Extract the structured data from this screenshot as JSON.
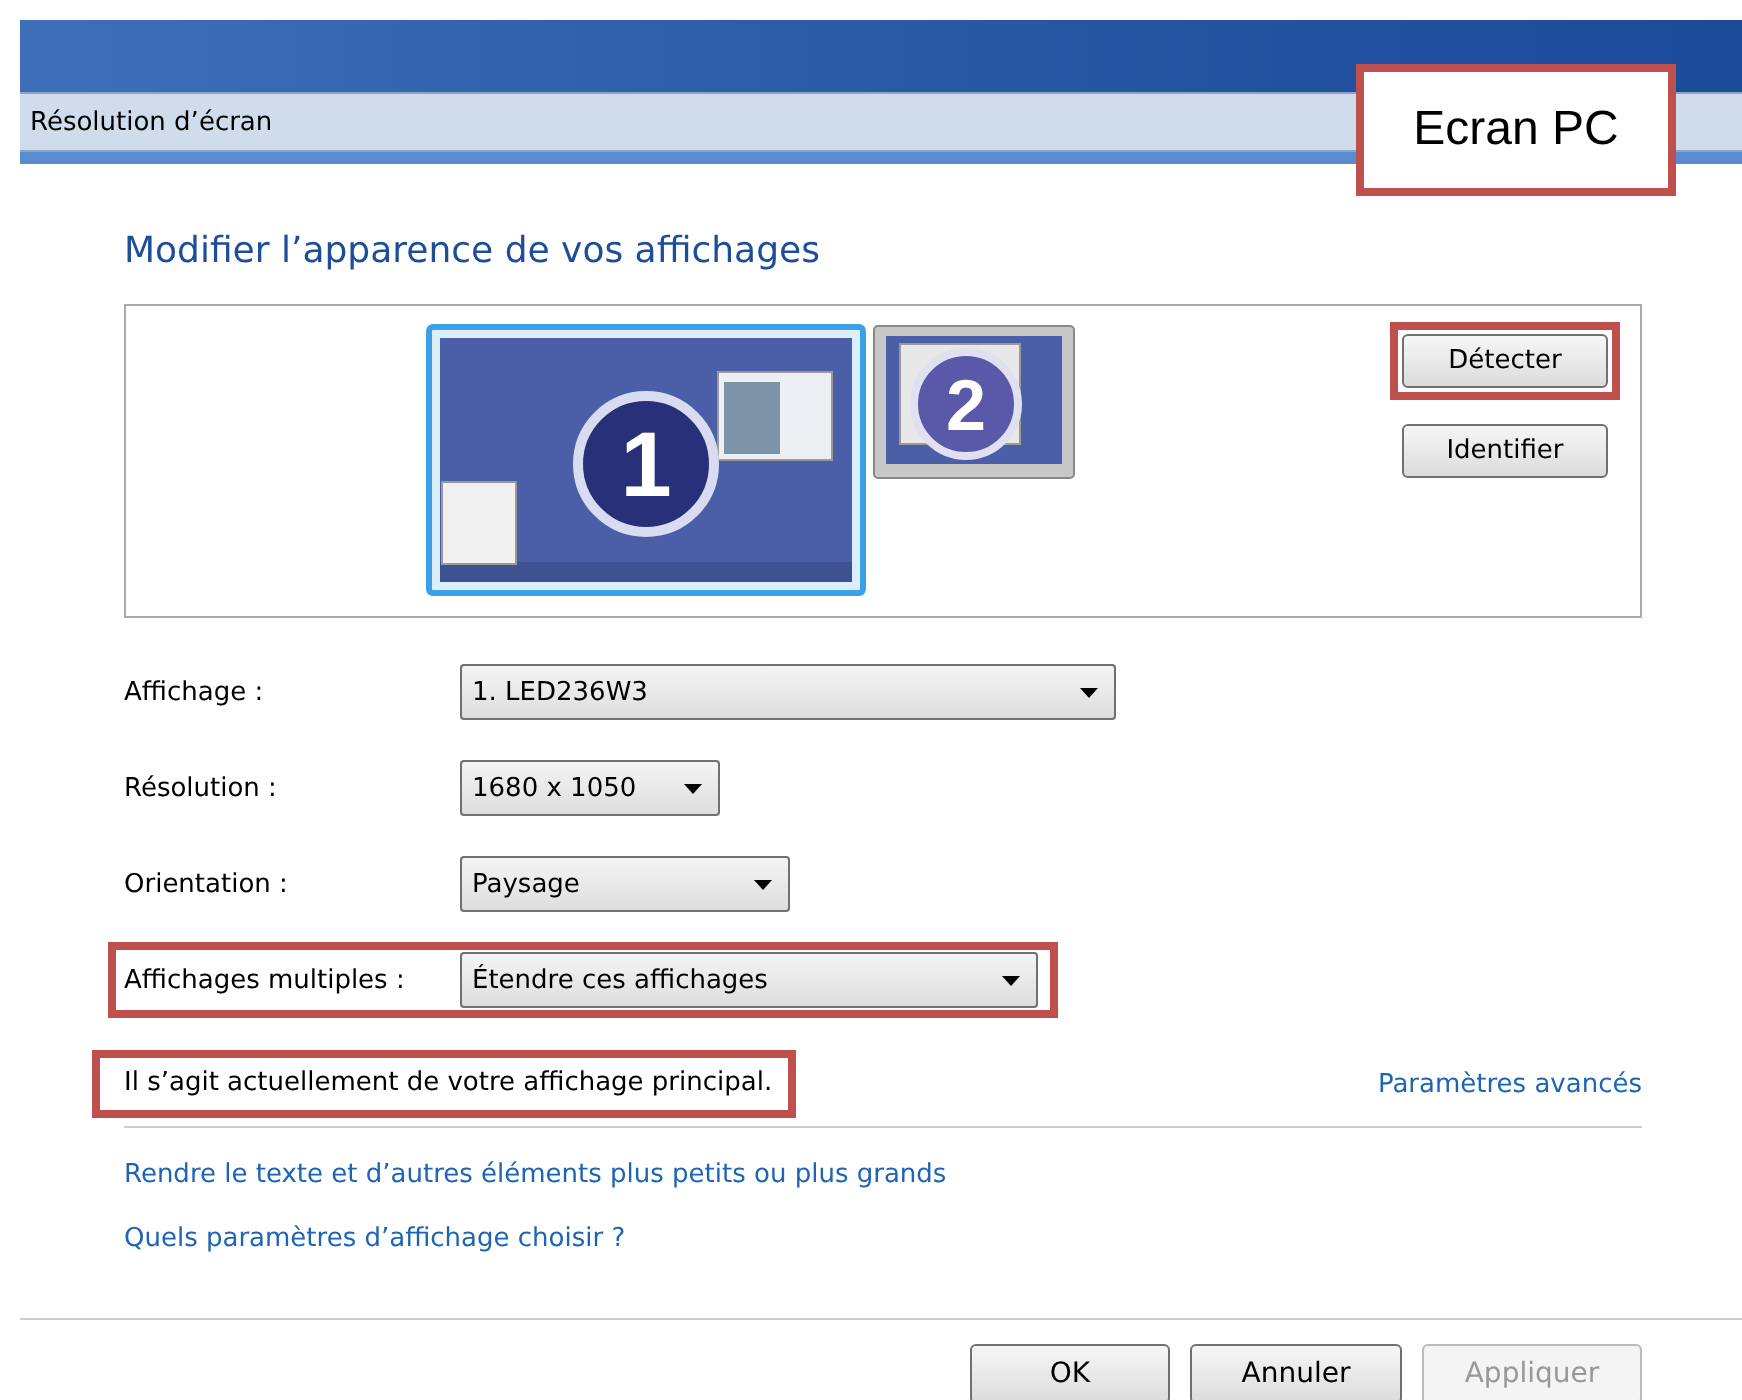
{
  "breadcrumb": "Résolution d’écran",
  "callout": {
    "text": "Ecran PC"
  },
  "heading": "Modifier l’apparence de vos affichages",
  "monitors": [
    {
      "number": "1",
      "selected": true
    },
    {
      "number": "2",
      "selected": false
    }
  ],
  "panel_buttons": [
    {
      "label": "Détecter",
      "annotated": true
    },
    {
      "label": "Identifier",
      "annotated": false
    }
  ],
  "fields": [
    {
      "label": "Affichage :",
      "value": "1. LED236W3",
      "annotated": false
    },
    {
      "label": "Résolution :",
      "value": "1680 x 1050",
      "annotated": false
    },
    {
      "label": "Orientation :",
      "value": "Paysage",
      "annotated": false
    },
    {
      "label": "Affichages multiples :",
      "value": "Étendre ces affichages",
      "annotated": true
    }
  ],
  "info": {
    "text": "Il s’agit actuellement de votre affichage principal.",
    "annotated": true
  },
  "advanced_link": "Paramètres avancés",
  "links": [
    "Rendre le texte et d’autres éléments plus petits ou plus grands",
    "Quels paramètres d’affichage choisir ?"
  ],
  "buttons": [
    {
      "label": "OK",
      "disabled": false
    },
    {
      "label": "Annuler",
      "disabled": false
    },
    {
      "label": "Appliquer",
      "disabled": true
    }
  ]
}
